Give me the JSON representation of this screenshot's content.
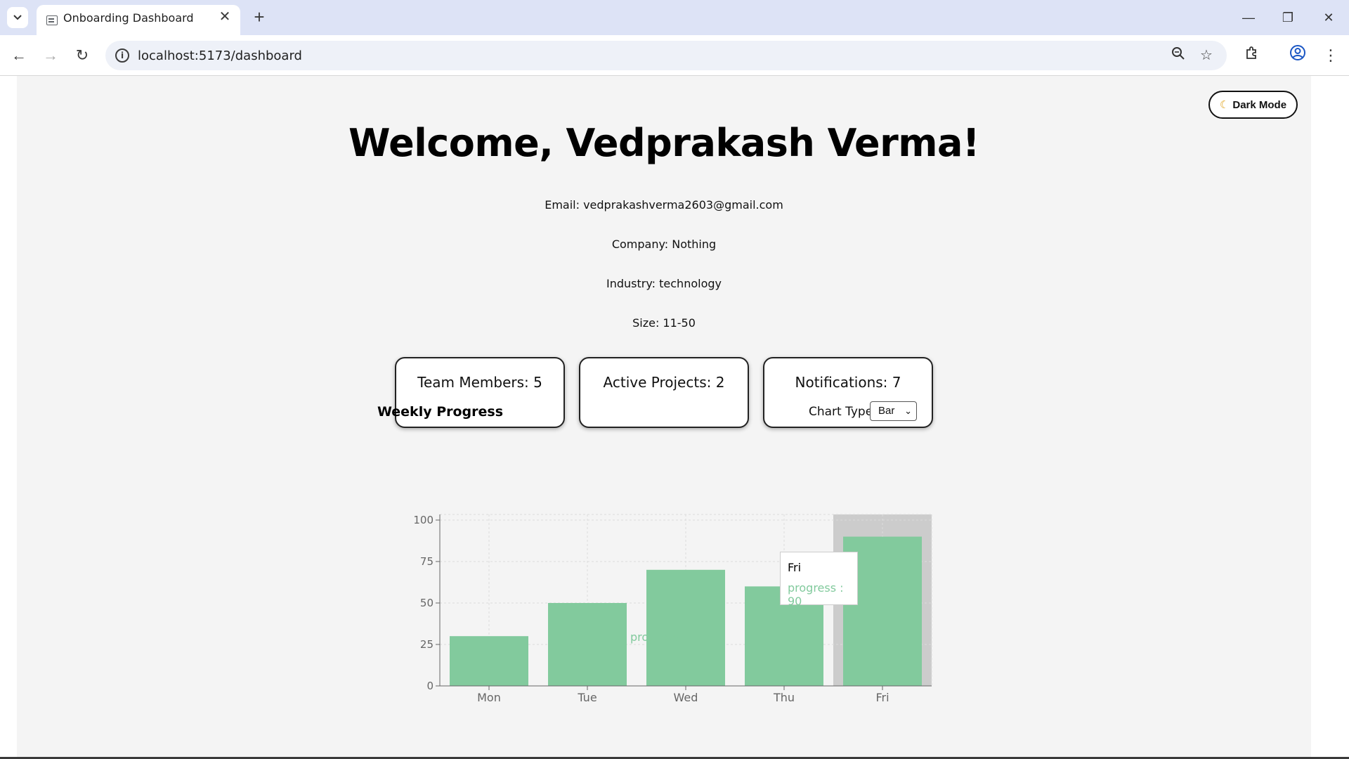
{
  "browser": {
    "tab_title": "Onboarding Dashboard",
    "url": "localhost:5173/dashboard"
  },
  "dashboard": {
    "dark_mode_label": "Dark Mode",
    "welcome": "Welcome, Vedprakash Verma!",
    "email": "Email: vedprakashverma2603@gmail.com",
    "company": "Company: Nothing",
    "industry": "Industry: technology",
    "size": "Size: 11-50",
    "cards": [
      {
        "label": "Team Members: 5"
      },
      {
        "label": "Active Projects: 2"
      },
      {
        "label": "Notifications: 7"
      }
    ],
    "chart_title": "Weekly Progress",
    "chart_type_label": "Chart Type:",
    "chart_type_value": "Bar"
  },
  "tooltip": {
    "label": "Fri",
    "value_text": "progress : 90"
  },
  "colors": {
    "bar": "#82ca9d",
    "highlight": "#cccccc",
    "grid": "#dddddd"
  },
  "chart_data": {
    "type": "bar",
    "categories": [
      "Mon",
      "Tue",
      "Wed",
      "Thu",
      "Fri"
    ],
    "series": [
      {
        "name": "progress",
        "values": [
          30,
          50,
          70,
          60,
          90
        ]
      }
    ],
    "ylim": [
      0,
      100
    ],
    "yticks": [
      0,
      25,
      50,
      75,
      100
    ],
    "grid": true,
    "legend": "bottom-center",
    "highlighted_category": "Fri"
  }
}
